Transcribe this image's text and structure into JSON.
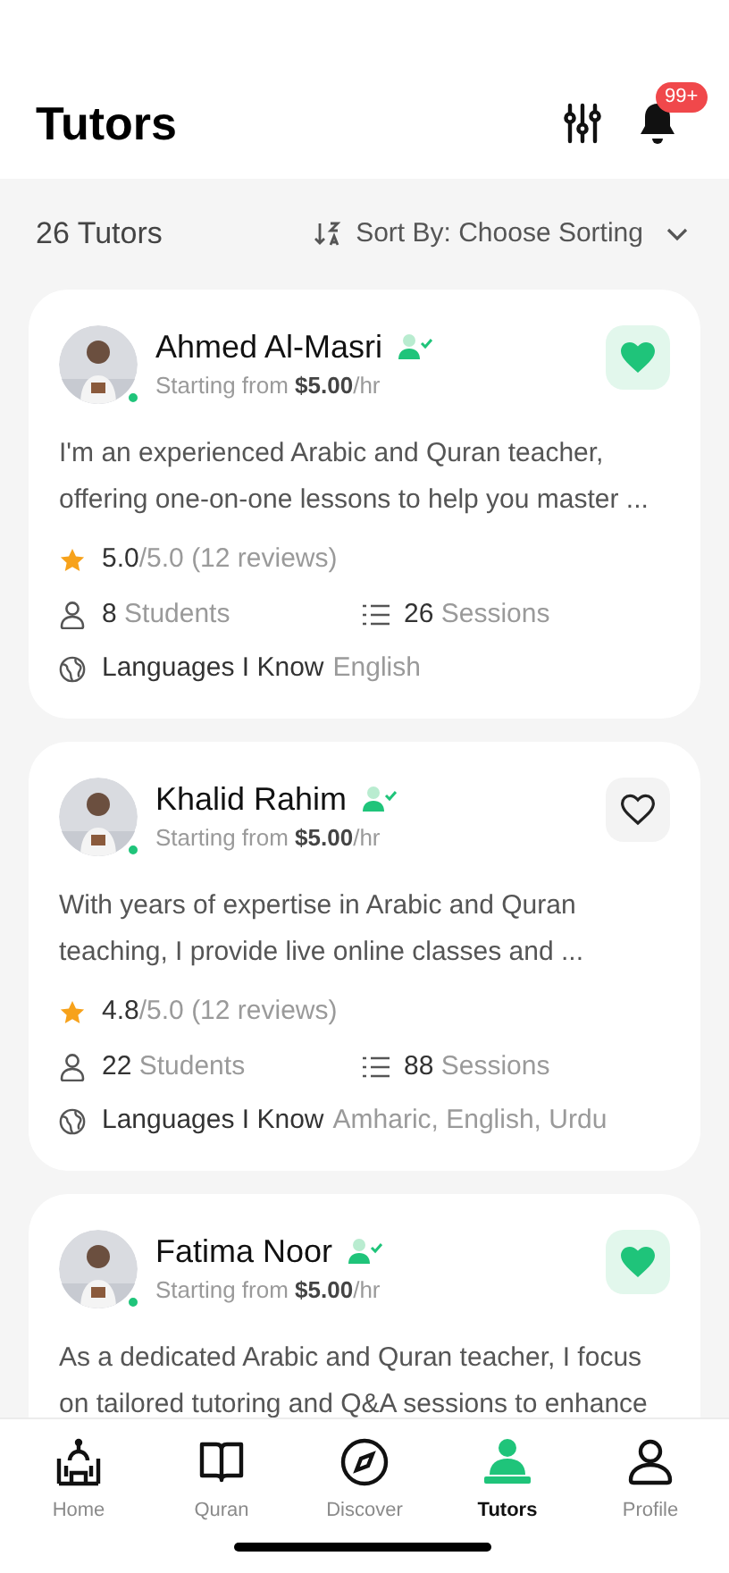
{
  "header": {
    "title": "Tutors",
    "notification_badge": "99+"
  },
  "toolbar": {
    "count": "26 Tutors",
    "sort_label": "Sort By: Choose Sorting"
  },
  "tutors": [
    {
      "name": "Ahmed Al-Masri",
      "online": true,
      "favorite": true,
      "price_prefix": "Starting from",
      "price": "$5.00",
      "price_unit": "/hr",
      "bio": "I'm an experienced Arabic and Quran teacher, offering one-on-one lessons to help you master ...",
      "rating": "5.0",
      "rating_max": "/5.0",
      "reviews": "(12 reviews)",
      "students_count": "8",
      "students_label": "Students",
      "sessions_count": "26",
      "sessions_label": "Sessions",
      "languages_label": "Languages I Know",
      "languages": "English"
    },
    {
      "name": "Khalid Rahim",
      "online": true,
      "favorite": false,
      "price_prefix": "Starting from",
      "price": "$5.00",
      "price_unit": "/hr",
      "bio": "With years of expertise in Arabic and Quran teaching, I provide live online classes and ...",
      "rating": "4.8",
      "rating_max": "/5.0",
      "reviews": "(12 reviews)",
      "students_count": "22",
      "students_label": "Students",
      "sessions_count": "88",
      "sessions_label": "Sessions",
      "languages_label": "Languages I Know",
      "languages": "Amharic, English, Urdu"
    },
    {
      "name": "Fatima Noor",
      "online": true,
      "favorite": true,
      "price_prefix": "Starting from",
      "price": "$5.00",
      "price_unit": "/hr",
      "bio": "As a dedicated Arabic and Quran teacher, I focus on tailored tutoring and Q&A sessions to enhance"
    }
  ],
  "nav": [
    {
      "kind": "home",
      "label": "Home",
      "selected": false
    },
    {
      "kind": "quran",
      "label": "Quran",
      "selected": false
    },
    {
      "kind": "discover",
      "label": "Discover",
      "selected": false
    },
    {
      "kind": "tutors",
      "label": "Tutors",
      "selected": true
    },
    {
      "kind": "profile",
      "label": "Profile",
      "selected": false
    }
  ]
}
